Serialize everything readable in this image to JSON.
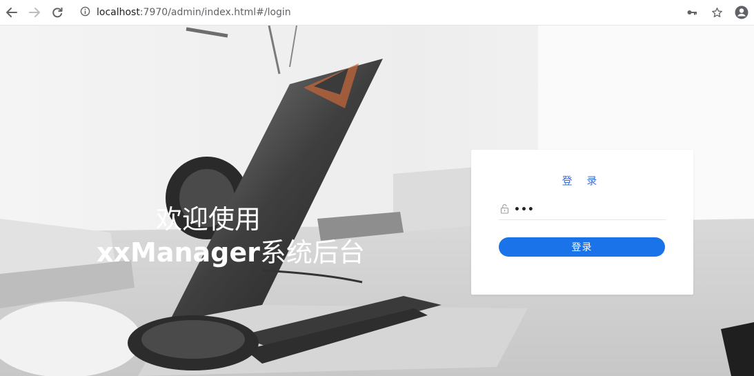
{
  "browser": {
    "url_host": "localhost",
    "url_rest": ":7970/admin/index.html#/login",
    "icons": [
      "back-arrow-icon",
      "forward-arrow-icon",
      "reload-icon",
      "info-icon",
      "key-icon",
      "star-icon",
      "account-icon"
    ]
  },
  "welcome": {
    "line1": "欢迎使用",
    "line2_latin": "xxManager",
    "line2_cjk": "系统后台"
  },
  "login": {
    "title": "登 录",
    "password_value": "•••",
    "button_label": "登录",
    "accent_color": "#1a73e8"
  }
}
